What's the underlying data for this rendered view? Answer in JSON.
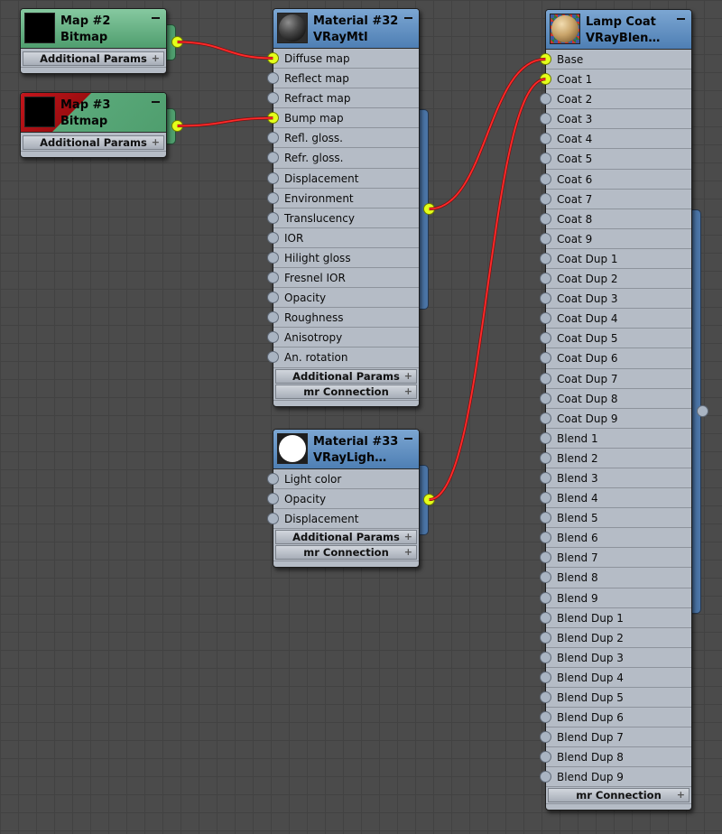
{
  "colors": {
    "canvas": "#4b4b4b",
    "node_body": "#b5bcc6",
    "header_material": "#5b8bbf",
    "header_map": "#5aa97a",
    "map_error": "#c4161c",
    "socket_active": "#e4ff1a",
    "socket_idle": "#a9b4c2",
    "wire": "#ff2a2a"
  },
  "nodes": {
    "map2": {
      "title": "Map #2",
      "subtitle": "Bitmap",
      "groups": [
        "Additional Params"
      ]
    },
    "map3": {
      "title": "Map #3",
      "subtitle": "Bitmap",
      "groups": [
        "Additional Params"
      ]
    },
    "mat32": {
      "title": "Material #32",
      "subtitle": "VRayMtl",
      "slots": [
        "Diffuse map",
        "Reflect map",
        "Refract map",
        "Bump map",
        "Refl. gloss.",
        "Refr. gloss.",
        "Displacement",
        "Environment",
        "Translucency",
        "IOR",
        "Hilight gloss",
        "Fresnel IOR",
        "Opacity",
        "Roughness",
        "Anisotropy",
        "An. rotation"
      ],
      "groups": [
        "Additional Params",
        "mr Connection"
      ]
    },
    "mat33": {
      "title": "Material #33",
      "subtitle": "VRayLigh…",
      "slots": [
        "Light color",
        "Opacity",
        "Displacement"
      ],
      "groups": [
        "Additional Params",
        "mr Connection"
      ]
    },
    "lamp": {
      "title": "Lamp Coat",
      "subtitle": "VRayBlen…",
      "slots": [
        "Base",
        "Coat 1",
        "Coat 2",
        "Coat 3",
        "Coat 4",
        "Coat 5",
        "Coat 6",
        "Coat 7",
        "Coat 8",
        "Coat 9",
        "Coat Dup 1",
        "Coat Dup 2",
        "Coat Dup 3",
        "Coat Dup 4",
        "Coat Dup 5",
        "Coat Dup 6",
        "Coat Dup 7",
        "Coat Dup 8",
        "Coat Dup 9",
        "Blend 1",
        "Blend 2",
        "Blend 3",
        "Blend 4",
        "Blend 5",
        "Blend 6",
        "Blend 7",
        "Blend 8",
        "Blend 9",
        "Blend Dup 1",
        "Blend Dup 2",
        "Blend Dup 3",
        "Blend Dup 4",
        "Blend Dup 5",
        "Blend Dup 6",
        "Blend Dup 7",
        "Blend Dup 8",
        "Blend Dup 9"
      ],
      "groups": [
        "mr Connection"
      ]
    }
  },
  "connected_inputs": {
    "mat32": [
      "Diffuse map",
      "Bump map"
    ],
    "lamp": [
      "Base",
      "Coat 1"
    ]
  },
  "connections": [
    {
      "from": "map2",
      "to_node": "mat32",
      "to_slot": "Diffuse map"
    },
    {
      "from": "map3",
      "to_node": "mat32",
      "to_slot": "Bump map"
    },
    {
      "from": "mat32",
      "to_node": "lamp",
      "to_slot": "Base"
    },
    {
      "from": "mat33",
      "to_node": "lamp",
      "to_slot": "Coat 1"
    }
  ]
}
